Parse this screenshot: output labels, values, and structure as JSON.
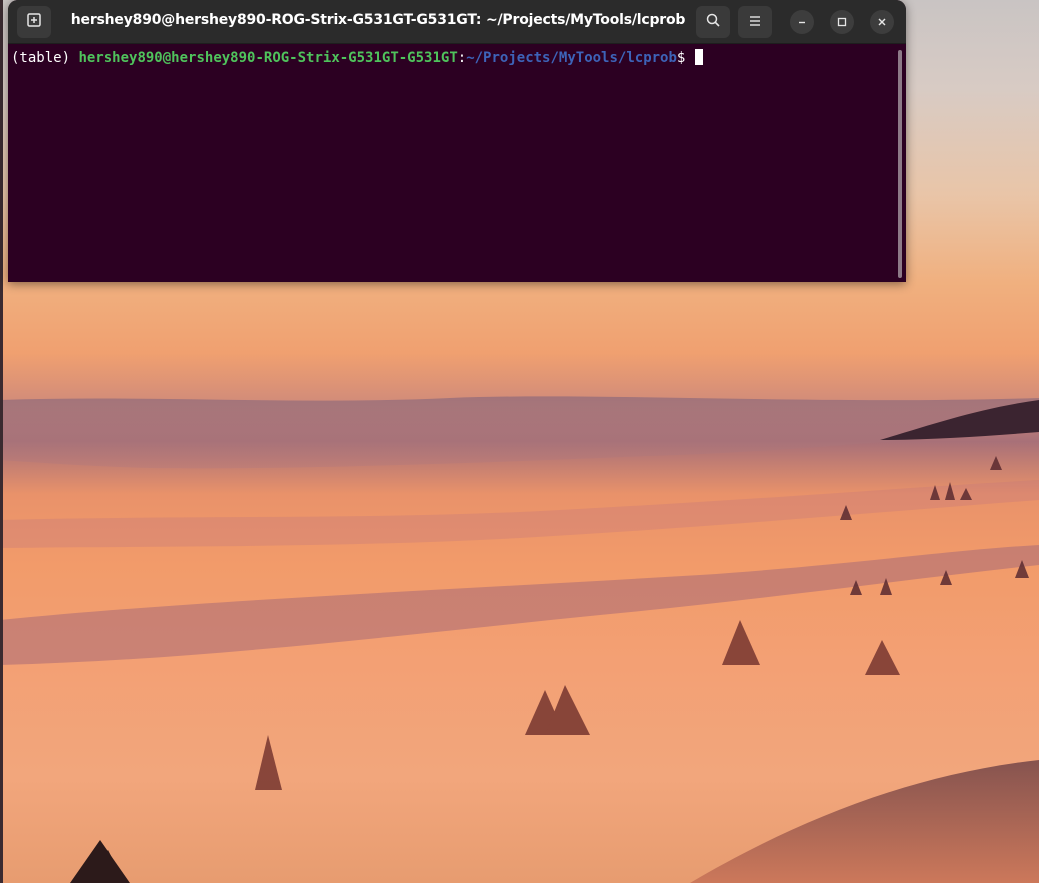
{
  "terminal": {
    "title": "hershey890@hershey890-ROG-Strix-G531GT-G531GT: ~/Projects/MyTools/lcprob",
    "prompt": {
      "env": "(table)",
      "userhost": "hershey890@hershey890-ROG-Strix-G531GT-G531GT",
      "separator": ":",
      "path": "~/Projects/MyTools/lcprob",
      "symbol": "$"
    },
    "icons": {
      "new_tab": "new-tab-icon",
      "search": "search-icon",
      "menu": "hamburger-menu-icon",
      "minimize": "minimize-icon",
      "maximize": "maximize-icon",
      "close": "close-icon"
    },
    "colors": {
      "background": "#2c0022",
      "titlebar": "#2b2b2b",
      "userhost": "#4fc35c",
      "path": "#3d63b8"
    }
  },
  "desktop": {
    "wallpaper": "foggy-sunset-hills"
  }
}
